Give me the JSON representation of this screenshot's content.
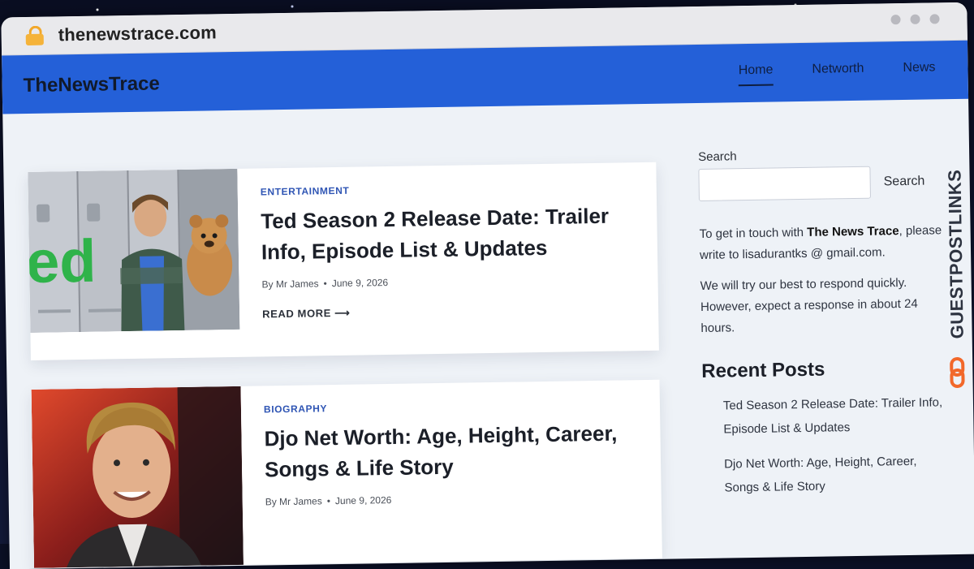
{
  "browser": {
    "url": "thenewstrace.com"
  },
  "site": {
    "logo": "TheNewsTrace",
    "nav": [
      {
        "label": "Home",
        "active": true
      },
      {
        "label": "Networth",
        "active": false
      },
      {
        "label": "News",
        "active": false
      }
    ]
  },
  "posts": [
    {
      "category": "ENTERTAINMENT",
      "title": "Ted Season 2 Release Date: Trailer Info, Episode List & Updates",
      "author": "By Mr James",
      "date": "June 9, 2026",
      "read_more": "READ MORE",
      "thumb_logo_text": "ed"
    },
    {
      "category": "BIOGRAPHY",
      "title": "Djo Net Worth: Age, Height, Career, Songs & Life Story",
      "author": "By Mr James",
      "date": "June 9, 2026"
    }
  ],
  "sidebar": {
    "search_label": "Search",
    "search_button": "Search",
    "contact_prefix": "To get in touch with ",
    "contact_name": "The News Trace",
    "contact_suffix": ", please write to lisadurantks @ gmail.com.",
    "response_text": "We will try our best to respond quickly. However, expect a response in about 24 hours.",
    "recent_heading": "Recent Posts",
    "recent_posts": [
      "Ted Season 2 Release Date: Trailer Info, Episode List & Updates",
      "Djo Net Worth: Age, Height, Career, Songs & Life Story"
    ]
  },
  "watermark": {
    "text": "GUESTPOSTLINKS"
  },
  "colors": {
    "header_blue": "#2460d8",
    "accent_orange": "#f2682a"
  }
}
